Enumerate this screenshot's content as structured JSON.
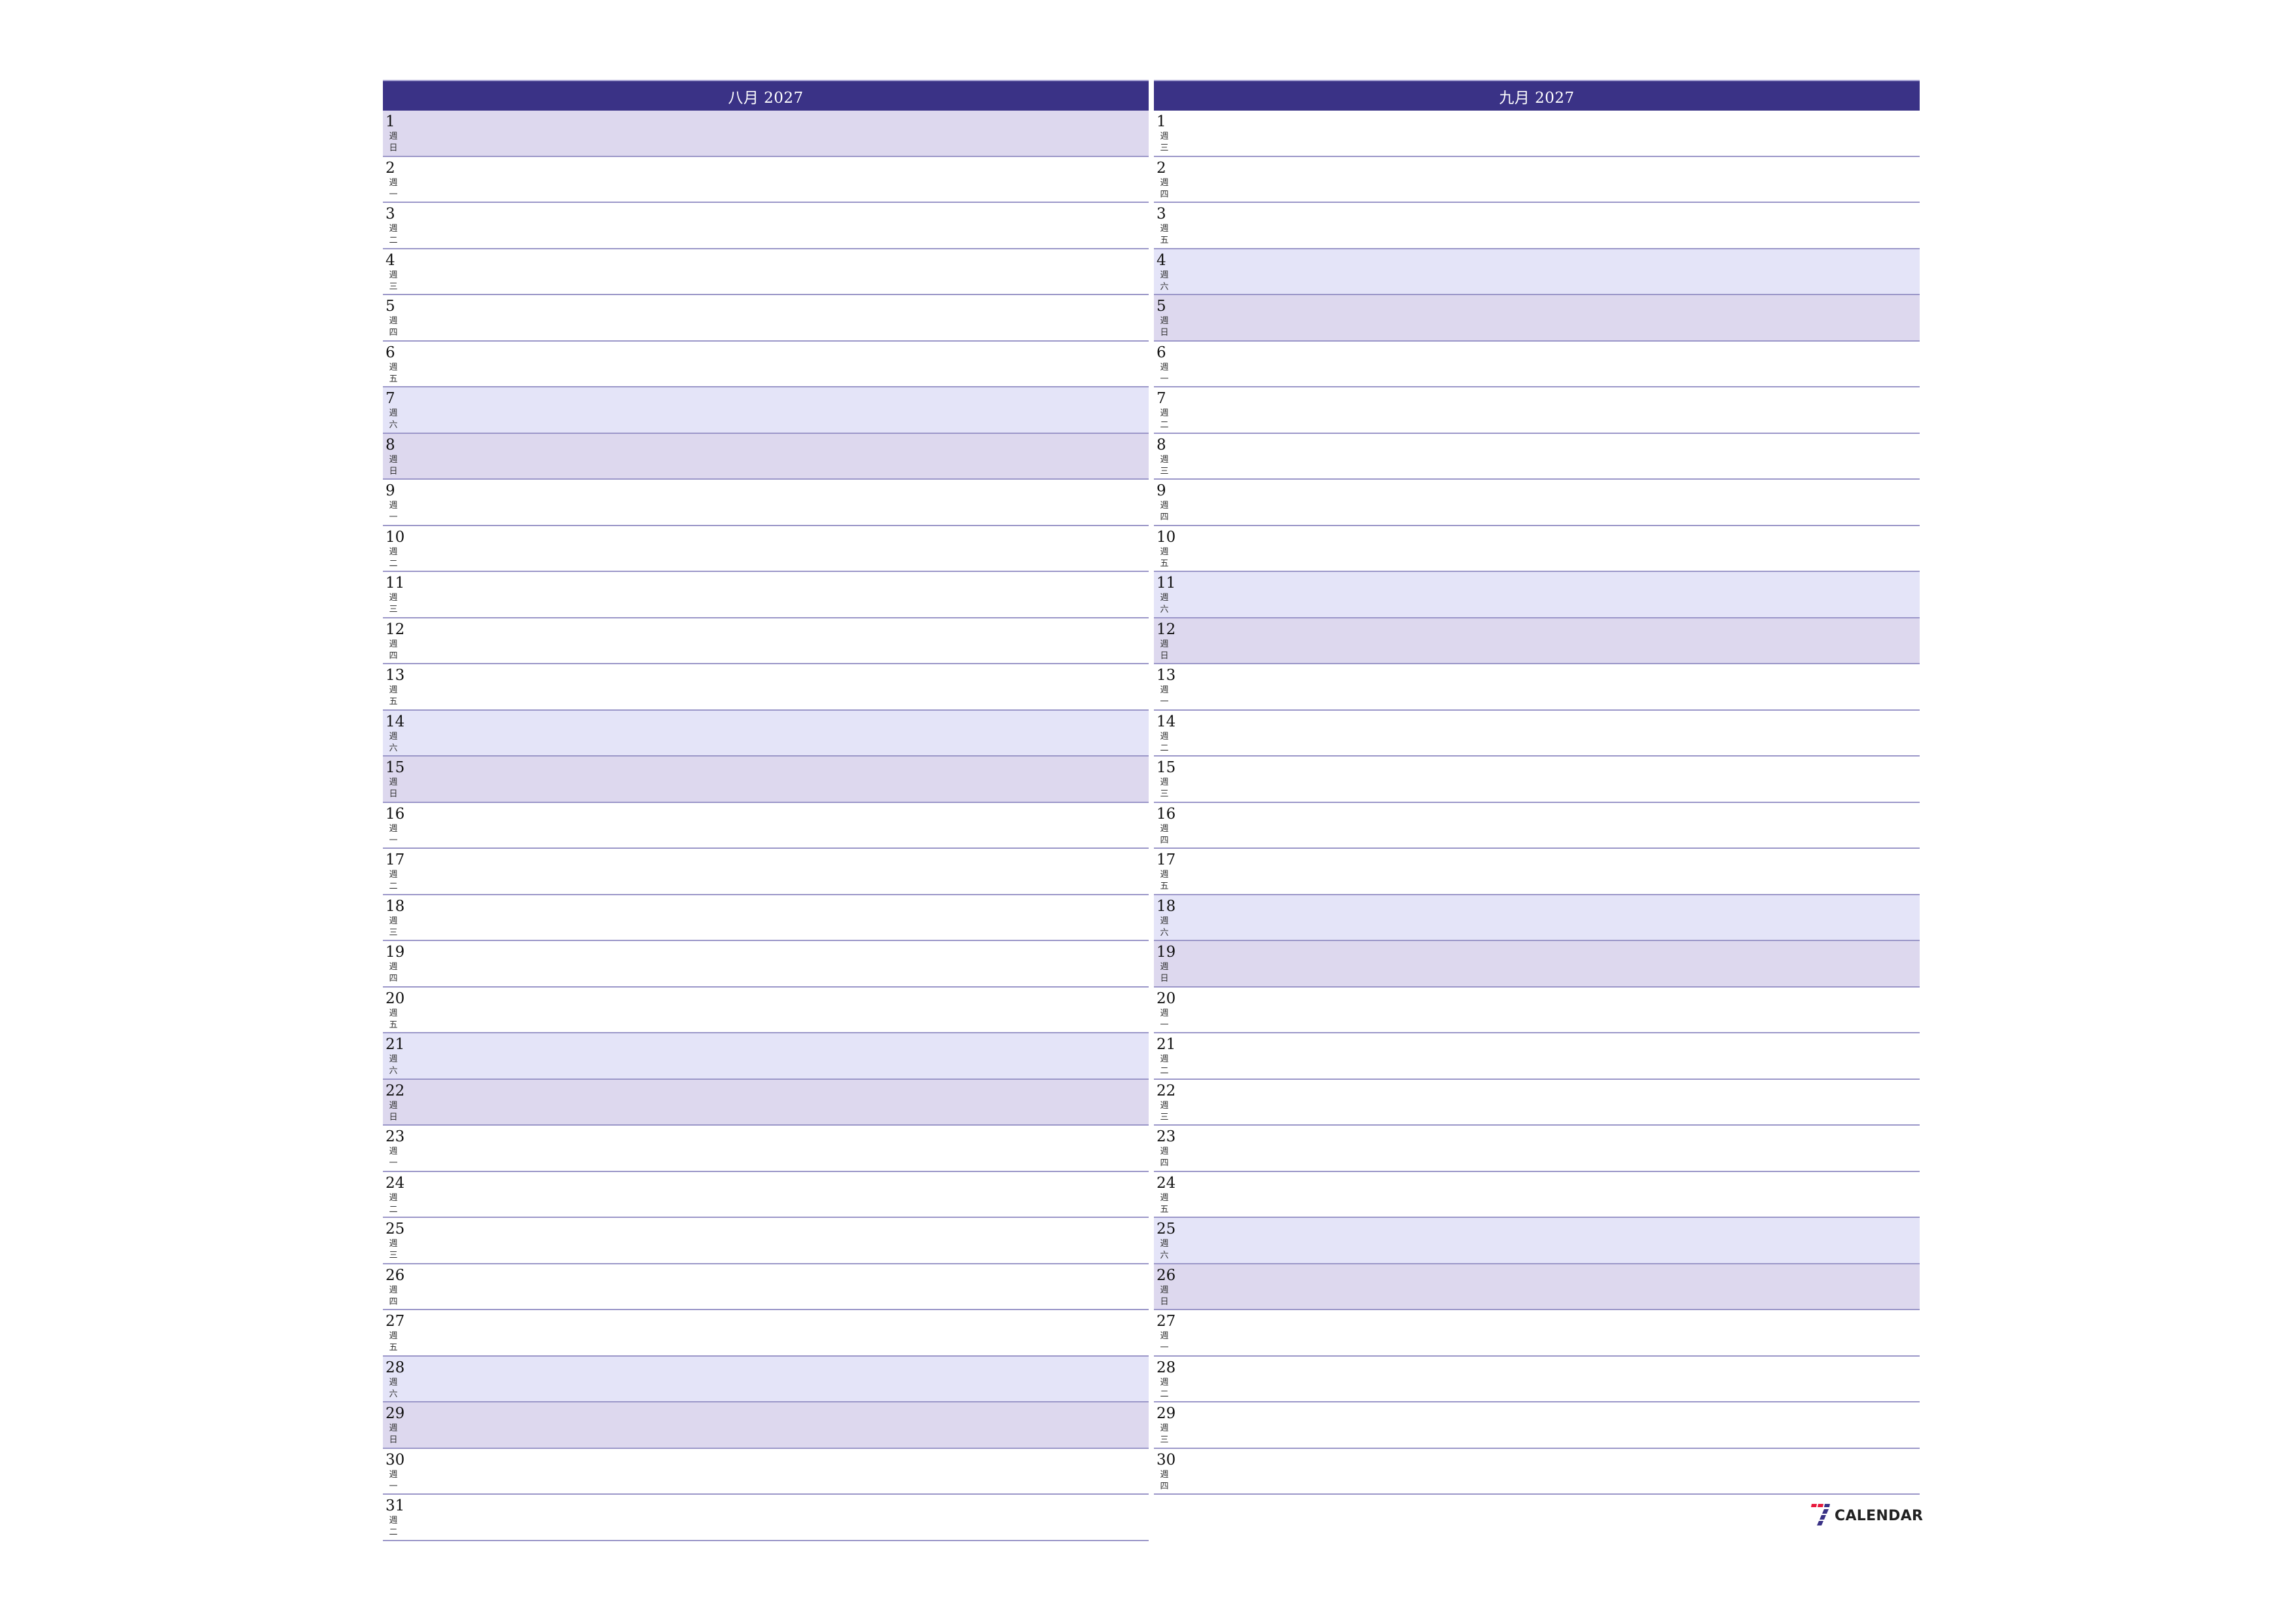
{
  "colors": {
    "header_bg": "#3a3286",
    "saturday_bg": "#e4e4f8",
    "sunday_bg": "#ddd8ee",
    "row_border": "#9a96c8"
  },
  "months": [
    {
      "title": "八月 2027",
      "days": [
        {
          "num": "1",
          "wd1": "週",
          "wd2": "日",
          "type": "sun"
        },
        {
          "num": "2",
          "wd1": "週",
          "wd2": "一",
          "type": "wk"
        },
        {
          "num": "3",
          "wd1": "週",
          "wd2": "二",
          "type": "wk"
        },
        {
          "num": "4",
          "wd1": "週",
          "wd2": "三",
          "type": "wk"
        },
        {
          "num": "5",
          "wd1": "週",
          "wd2": "四",
          "type": "wk"
        },
        {
          "num": "6",
          "wd1": "週",
          "wd2": "五",
          "type": "wk"
        },
        {
          "num": "7",
          "wd1": "週",
          "wd2": "六",
          "type": "sat"
        },
        {
          "num": "8",
          "wd1": "週",
          "wd2": "日",
          "type": "sun"
        },
        {
          "num": "9",
          "wd1": "週",
          "wd2": "一",
          "type": "wk"
        },
        {
          "num": "10",
          "wd1": "週",
          "wd2": "二",
          "type": "wk"
        },
        {
          "num": "11",
          "wd1": "週",
          "wd2": "三",
          "type": "wk"
        },
        {
          "num": "12",
          "wd1": "週",
          "wd2": "四",
          "type": "wk"
        },
        {
          "num": "13",
          "wd1": "週",
          "wd2": "五",
          "type": "wk"
        },
        {
          "num": "14",
          "wd1": "週",
          "wd2": "六",
          "type": "sat"
        },
        {
          "num": "15",
          "wd1": "週",
          "wd2": "日",
          "type": "sun"
        },
        {
          "num": "16",
          "wd1": "週",
          "wd2": "一",
          "type": "wk"
        },
        {
          "num": "17",
          "wd1": "週",
          "wd2": "二",
          "type": "wk"
        },
        {
          "num": "18",
          "wd1": "週",
          "wd2": "三",
          "type": "wk"
        },
        {
          "num": "19",
          "wd1": "週",
          "wd2": "四",
          "type": "wk"
        },
        {
          "num": "20",
          "wd1": "週",
          "wd2": "五",
          "type": "wk"
        },
        {
          "num": "21",
          "wd1": "週",
          "wd2": "六",
          "type": "sat"
        },
        {
          "num": "22",
          "wd1": "週",
          "wd2": "日",
          "type": "sun"
        },
        {
          "num": "23",
          "wd1": "週",
          "wd2": "一",
          "type": "wk"
        },
        {
          "num": "24",
          "wd1": "週",
          "wd2": "二",
          "type": "wk"
        },
        {
          "num": "25",
          "wd1": "週",
          "wd2": "三",
          "type": "wk"
        },
        {
          "num": "26",
          "wd1": "週",
          "wd2": "四",
          "type": "wk"
        },
        {
          "num": "27",
          "wd1": "週",
          "wd2": "五",
          "type": "wk"
        },
        {
          "num": "28",
          "wd1": "週",
          "wd2": "六",
          "type": "sat"
        },
        {
          "num": "29",
          "wd1": "週",
          "wd2": "日",
          "type": "sun"
        },
        {
          "num": "30",
          "wd1": "週",
          "wd2": "一",
          "type": "wk"
        },
        {
          "num": "31",
          "wd1": "週",
          "wd2": "二",
          "type": "wk"
        }
      ]
    },
    {
      "title": "九月 2027",
      "days": [
        {
          "num": "1",
          "wd1": "週",
          "wd2": "三",
          "type": "wk"
        },
        {
          "num": "2",
          "wd1": "週",
          "wd2": "四",
          "type": "wk"
        },
        {
          "num": "3",
          "wd1": "週",
          "wd2": "五",
          "type": "wk"
        },
        {
          "num": "4",
          "wd1": "週",
          "wd2": "六",
          "type": "sat"
        },
        {
          "num": "5",
          "wd1": "週",
          "wd2": "日",
          "type": "sun"
        },
        {
          "num": "6",
          "wd1": "週",
          "wd2": "一",
          "type": "wk"
        },
        {
          "num": "7",
          "wd1": "週",
          "wd2": "二",
          "type": "wk"
        },
        {
          "num": "8",
          "wd1": "週",
          "wd2": "三",
          "type": "wk"
        },
        {
          "num": "9",
          "wd1": "週",
          "wd2": "四",
          "type": "wk"
        },
        {
          "num": "10",
          "wd1": "週",
          "wd2": "五",
          "type": "wk"
        },
        {
          "num": "11",
          "wd1": "週",
          "wd2": "六",
          "type": "sat"
        },
        {
          "num": "12",
          "wd1": "週",
          "wd2": "日",
          "type": "sun"
        },
        {
          "num": "13",
          "wd1": "週",
          "wd2": "一",
          "type": "wk"
        },
        {
          "num": "14",
          "wd1": "週",
          "wd2": "二",
          "type": "wk"
        },
        {
          "num": "15",
          "wd1": "週",
          "wd2": "三",
          "type": "wk"
        },
        {
          "num": "16",
          "wd1": "週",
          "wd2": "四",
          "type": "wk"
        },
        {
          "num": "17",
          "wd1": "週",
          "wd2": "五",
          "type": "wk"
        },
        {
          "num": "18",
          "wd1": "週",
          "wd2": "六",
          "type": "sat"
        },
        {
          "num": "19",
          "wd1": "週",
          "wd2": "日",
          "type": "sun"
        },
        {
          "num": "20",
          "wd1": "週",
          "wd2": "一",
          "type": "wk"
        },
        {
          "num": "21",
          "wd1": "週",
          "wd2": "二",
          "type": "wk"
        },
        {
          "num": "22",
          "wd1": "週",
          "wd2": "三",
          "type": "wk"
        },
        {
          "num": "23",
          "wd1": "週",
          "wd2": "四",
          "type": "wk"
        },
        {
          "num": "24",
          "wd1": "週",
          "wd2": "五",
          "type": "wk"
        },
        {
          "num": "25",
          "wd1": "週",
          "wd2": "六",
          "type": "sat"
        },
        {
          "num": "26",
          "wd1": "週",
          "wd2": "日",
          "type": "sun"
        },
        {
          "num": "27",
          "wd1": "週",
          "wd2": "一",
          "type": "wk"
        },
        {
          "num": "28",
          "wd1": "週",
          "wd2": "二",
          "type": "wk"
        },
        {
          "num": "29",
          "wd1": "週",
          "wd2": "三",
          "type": "wk"
        },
        {
          "num": "30",
          "wd1": "週",
          "wd2": "四",
          "type": "wk"
        }
      ]
    }
  ],
  "logo": {
    "text": "CALENDAR",
    "icon": "seven-icon",
    "mark_colors": {
      "top": "#e8193c",
      "stem": "#3a3286"
    }
  }
}
